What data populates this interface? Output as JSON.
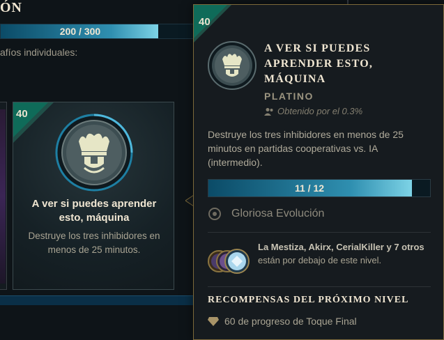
{
  "section_title": "ÓN",
  "main_progress": {
    "label": "200 / 300",
    "fraction": 0.6667
  },
  "subtitle": "afíos individuales:",
  "card": {
    "level": "40",
    "title": "A ver si puedes aprender esto, máquina",
    "description": "Destruye los tres inhibidores en menos de 25 minutos."
  },
  "tooltip": {
    "level": "40",
    "title": "A VER SI PUEDES APRENDER ESTO, MÁQUINA",
    "tier": "PLATINO",
    "owned": "Obtenido por el 0.3%",
    "description": "Destruye los tres inhibidores en menos de 25 minutos en partidas cooperativas vs. IA (intermedio).",
    "progress": {
      "label": "11 / 12",
      "fraction": 0.9167
    },
    "path_name": "Gloriosa Evolución",
    "friends": {
      "names": "La Mestiza, Akirx, CerialKiller y 7 otros",
      "suffix": " están por debajo de este nivel."
    },
    "rewards_title": "RECOMPENSAS DEL PRÓXIMO NIVEL",
    "reward": "60 de progreso de Toque Final"
  },
  "colors": {
    "accent_gold": "#7d6a3a",
    "progress_fill": "#2f8fb0",
    "level_corner": "#0f6b59"
  },
  "icons": [
    "crest-emblem-icon",
    "user-icon",
    "path-target-icon",
    "friend-avatar-icon",
    "reward-gem-icon"
  ]
}
